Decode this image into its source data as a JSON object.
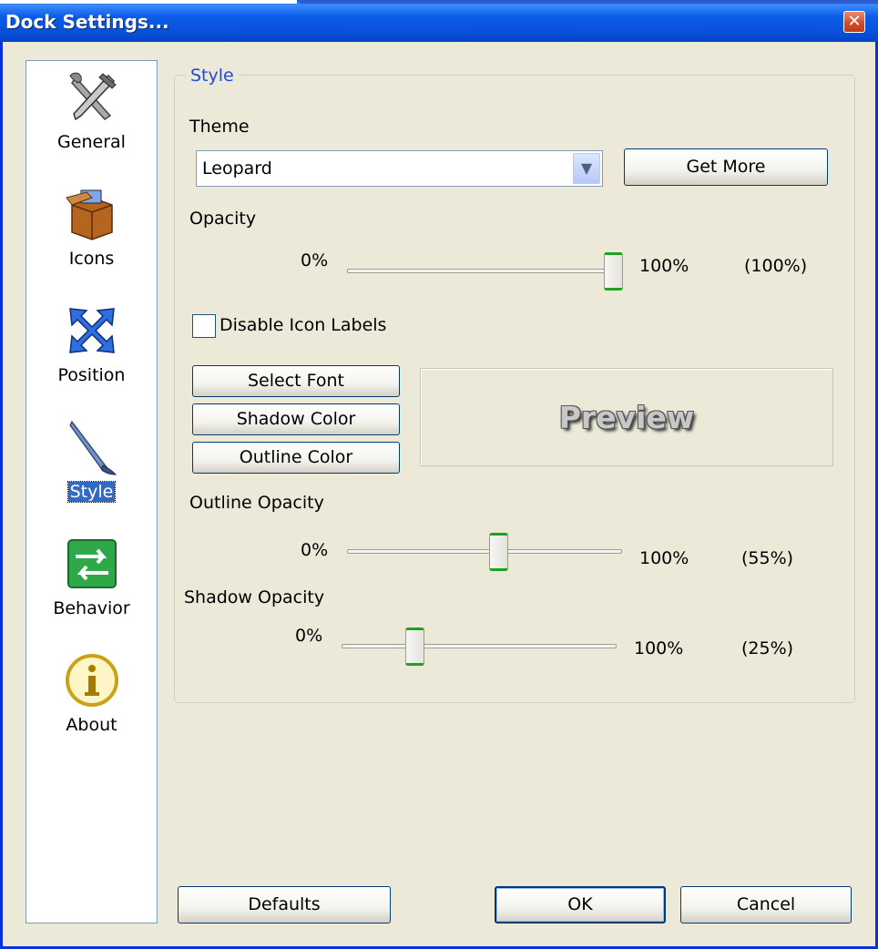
{
  "window": {
    "title": "Dock Settings...",
    "close_glyph": "✕"
  },
  "sidebar": {
    "items": [
      {
        "label": "General",
        "icon": "tools-icon"
      },
      {
        "label": "Icons",
        "icon": "box-icon"
      },
      {
        "label": "Position",
        "icon": "arrows-icon"
      },
      {
        "label": "Style",
        "icon": "brush-icon",
        "selected": true
      },
      {
        "label": "Behavior",
        "icon": "swap-arrows-icon"
      },
      {
        "label": "About",
        "icon": "info-icon"
      }
    ]
  },
  "style": {
    "group_title": "Style",
    "theme_label": "Theme",
    "theme_value": "Leopard",
    "get_more_label": "Get More",
    "opacity": {
      "label": "Opacity",
      "min": "0%",
      "max": "100%",
      "value_text": "(100%)",
      "value": 100
    },
    "disable_labels": {
      "label": "Disable Icon Labels",
      "checked": false
    },
    "select_font_label": "Select Font",
    "shadow_color_label": "Shadow Color",
    "outline_color_label": "Outline Color",
    "preview_text": "Preview",
    "outline_opacity": {
      "label": "Outline Opacity",
      "min": "0%",
      "max": "100%",
      "value_text": "(55%)",
      "value": 55
    },
    "shadow_opacity": {
      "label": "Shadow Opacity",
      "min": "0%",
      "max": "100%",
      "value_text": "(25%)",
      "value": 25
    }
  },
  "footer": {
    "defaults_label": "Defaults",
    "ok_label": "OK",
    "cancel_label": "Cancel"
  },
  "colors": {
    "accent": "#316ac5",
    "titlebar": "#0850d8",
    "group_title": "#1f4dd4",
    "slider_thumb_edge": "#21a121"
  }
}
